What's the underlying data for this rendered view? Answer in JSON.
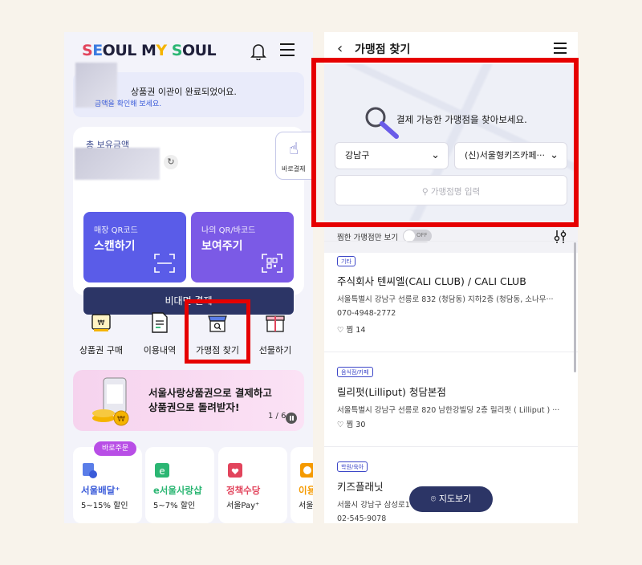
{
  "left": {
    "logo": {
      "parts": [
        "S",
        "E",
        "OUL M",
        "Y",
        " ",
        "S",
        "OUL"
      ]
    },
    "notice": {
      "line1": "상품권 이관이 완료되었어요.",
      "line2": "금액을 확인해 보세요."
    },
    "balance_label": "총 보유금액",
    "quick_pay_label": "바로결제",
    "scan": {
      "sub": "매장 QR코드",
      "title": "스캔하기"
    },
    "show": {
      "sub": "나의 QR/바코드",
      "title": "보여주기"
    },
    "nonface_pay": "비대면 결제",
    "quick_menu": [
      {
        "label": "상품권 구매",
        "icon": "voucher-icon"
      },
      {
        "label": "이용내역",
        "icon": "document-icon"
      },
      {
        "label": "가맹점 찾기",
        "icon": "store-search-icon"
      },
      {
        "label": "선물하기",
        "icon": "gift-icon"
      }
    ],
    "banner": {
      "line1": "서울사랑상품권으로 결제하고",
      "line2": "상품권으로 돌려받자!",
      "page": "1 / 6"
    },
    "service_badge": "바로주문",
    "services": [
      {
        "name": "서울배달⁺",
        "desc": "5~15% 할인",
        "color": "#3a5bd9"
      },
      {
        "name": "e서울사랑샵",
        "desc": "5~7% 할인",
        "color": "#2bb673"
      },
      {
        "name": "정책수당",
        "desc": "서울Pay⁺",
        "color": "#e2445c"
      },
      {
        "name": "이용",
        "desc": "서울",
        "color": "#f59a00"
      }
    ]
  },
  "right": {
    "title": "가맹점 찾기",
    "prompt": "결제 가능한 가맹점을 찾아보세요.",
    "district": "강남구",
    "category": "(신)서울형키즈카페···",
    "name_placeholder": "가맹점명 입력",
    "fav_only": "찜한 가맹점만 보기",
    "toggle_state": "OFF",
    "stores": [
      {
        "tag": "기타",
        "name": "주식회사 텐씨엘(CALI CLUB) / CALI CLUB",
        "addr": "서울특별시 강남구 선릉로 832 (청담동) 지하2층 (청담동, 소나무···",
        "phone": "070-4948-2772",
        "likes": "찜 14"
      },
      {
        "tag": "음식점/카페",
        "name": "릴리펏(Lilliput) 청담본점",
        "addr": "서울특별시 강남구 선릉로 820 남한강빌딩 2층 릴리펏 ( Lilliput ) ···",
        "phone": "",
        "likes": "찜 30"
      },
      {
        "tag": "학원/육아",
        "name": "키즈플래닛",
        "addr": "서울시 강남구 삼성로1",
        "phone": "02-545-9078",
        "likes": ""
      }
    ],
    "map_button": "지도보기"
  }
}
